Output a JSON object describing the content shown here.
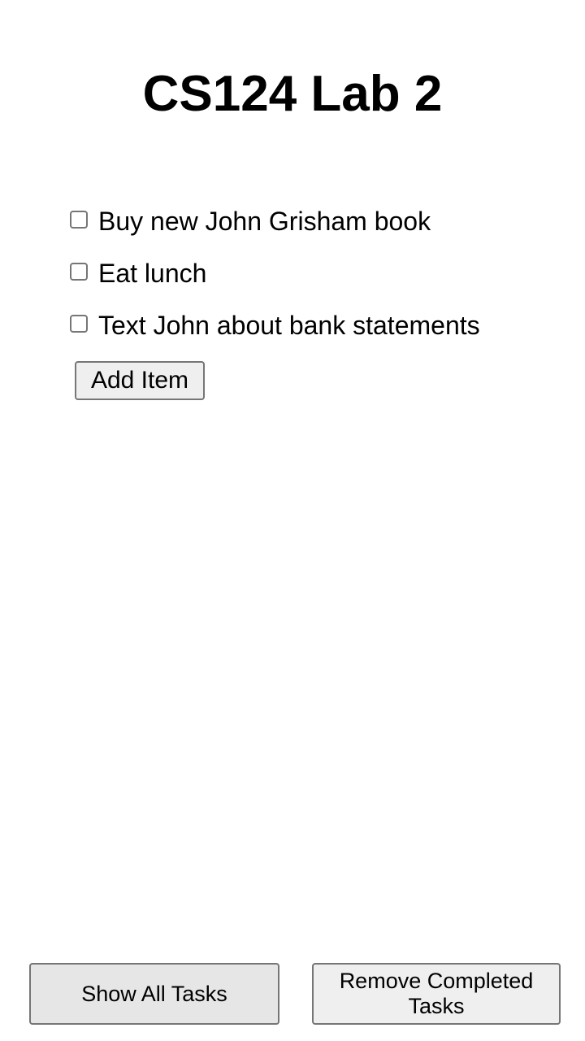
{
  "header": {
    "title": "CS124 Lab 2"
  },
  "tasks": [
    {
      "label": "Buy new John Grisham book",
      "checked": false
    },
    {
      "label": "Eat lunch",
      "checked": false
    },
    {
      "label": "Text John about bank statements",
      "checked": false
    }
  ],
  "actions": {
    "add_item_label": "Add Item",
    "show_all_label": "Show All Tasks",
    "remove_completed_label": "Remove Completed Tasks"
  }
}
